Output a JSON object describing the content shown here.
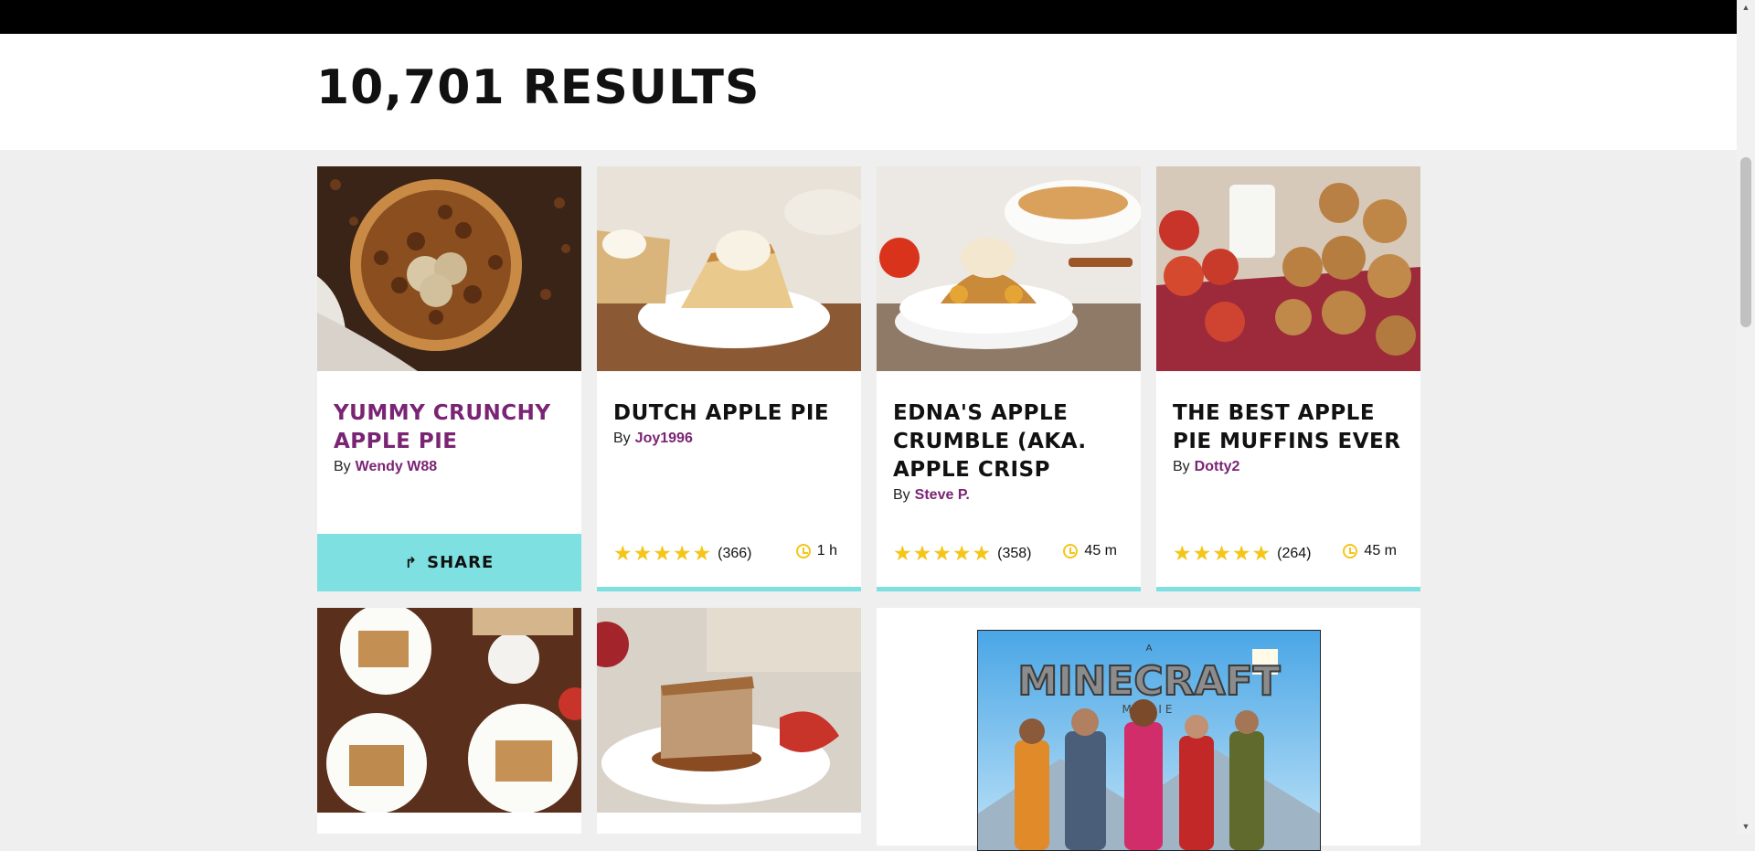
{
  "results": {
    "title": "10,701 RESULTS"
  },
  "share_label": "SHARE",
  "by_label": "By",
  "colors": {
    "accent": "#7ee0e0",
    "link": "#7a2474",
    "star": "#f5c518"
  },
  "cards": [
    {
      "title": "YUMMY CRUNCHY APPLE PIE",
      "author": "Wendy W88"
    },
    {
      "title": "DUTCH APPLE PIE",
      "author": "Joy1996",
      "rating_count": "(366)",
      "time": "1 h",
      "stars": 5
    },
    {
      "title": "EDNA'S APPLE CRUMBLE (AKA. APPLE CRISP",
      "author": "Steve P.",
      "rating_count": "(358)",
      "time": "45 m",
      "stars": 5
    },
    {
      "title": "THE BEST APPLE PIE MUFFINS EVER",
      "author": "Dotty2",
      "rating_count": "(264)",
      "time": "45 m",
      "stars": 5
    }
  ],
  "ad": {
    "poster_title": "MINECRAFT",
    "poster_subtitle": "MOVIE",
    "poster_prefix": "A"
  },
  "icons": {
    "share": "share-arrow-icon",
    "clock": "clock-icon",
    "star": "star-icon"
  }
}
